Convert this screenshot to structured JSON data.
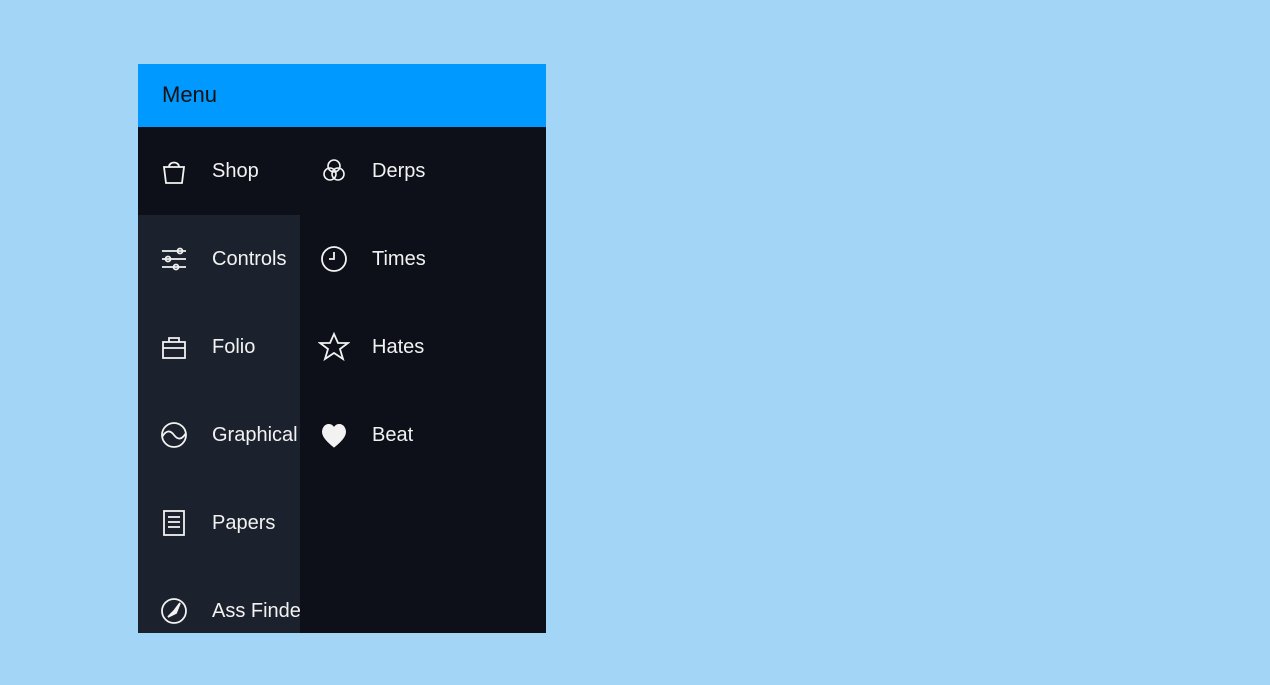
{
  "header": {
    "title": "Menu"
  },
  "main_items": [
    {
      "label": "Shop",
      "icon": "bag-icon"
    },
    {
      "label": "Controls",
      "icon": "sliders-icon"
    },
    {
      "label": "Folio",
      "icon": "briefcase-icon"
    },
    {
      "label": "Graphical",
      "icon": "graph-icon"
    },
    {
      "label": "Papers",
      "icon": "document-icon"
    },
    {
      "label": "Ass Finder",
      "icon": "compass-icon"
    }
  ],
  "submenu_items": [
    {
      "label": "Derps",
      "icon": "venn-icon"
    },
    {
      "label": "Times",
      "icon": "clock-icon"
    },
    {
      "label": "Hates",
      "icon": "star-icon"
    },
    {
      "label": "Beat",
      "icon": "heart-broken-icon"
    }
  ]
}
